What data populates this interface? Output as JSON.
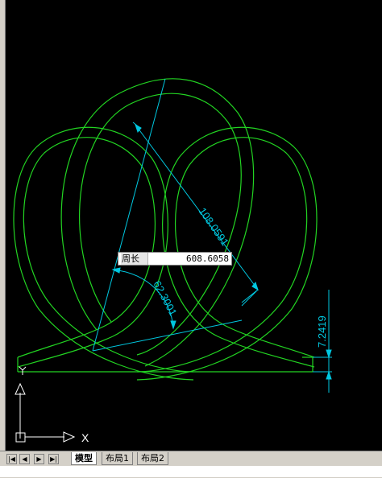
{
  "tooltip": {
    "label": "周长",
    "value": "608.6058"
  },
  "dimensions": {
    "aligned_top": "108.0591",
    "angular": "62.3001",
    "vertical": "7.2419"
  },
  "ucs": {
    "x_label": "X",
    "y_label": "Y"
  },
  "tabs": [
    {
      "label": "模型",
      "active": true
    },
    {
      "label": "布局1",
      "active": false
    },
    {
      "label": "布局2",
      "active": false
    }
  ],
  "nav_buttons": [
    "|◀",
    "◀",
    "▶",
    "▶|"
  ],
  "colors": {
    "background": "#000000",
    "geometry": "#22d422",
    "dimension": "#00c8e0",
    "ucs": "#ffffff"
  }
}
